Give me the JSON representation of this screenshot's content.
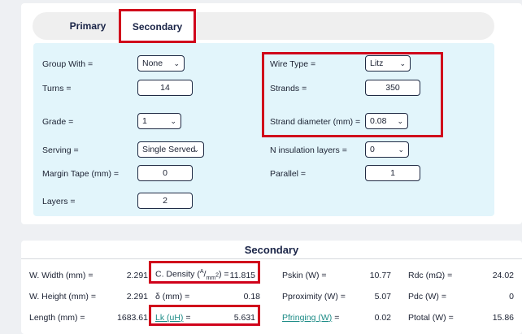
{
  "tabs": {
    "primary": "Primary",
    "secondary": "Secondary"
  },
  "form": {
    "group_with": {
      "label": "Group With =",
      "value": "None"
    },
    "turns": {
      "label": "Turns =",
      "value": "14"
    },
    "grade": {
      "label": "Grade =",
      "value": "1"
    },
    "serving": {
      "label": "Serving =",
      "value": "Single Served"
    },
    "margin_tape": {
      "label": "Margin Tape (mm) =",
      "value": "0"
    },
    "layers": {
      "label": "Layers =",
      "value": "2"
    },
    "wire_type": {
      "label": "Wire Type =",
      "value": "Litz"
    },
    "strands": {
      "label": "Strands =",
      "value": "350"
    },
    "strand_diameter": {
      "label": "Strand diameter (mm) =",
      "value": "0.08"
    },
    "insulation_layers": {
      "label": "N insulation layers =",
      "value": "0"
    },
    "parallel": {
      "label": "Parallel =",
      "value": "1"
    }
  },
  "results": {
    "title": "Secondary",
    "w_width": {
      "label": "W. Width (mm) =",
      "value": "2.291"
    },
    "w_height": {
      "label": "W. Height (mm) =",
      "value": "2.291"
    },
    "length": {
      "label": "Length (mm) =",
      "value": "1683.61"
    },
    "c_density": {
      "label_pre": "C. Density (",
      "label_num": "A",
      "label_slash": "/",
      "label_den": "mm",
      "label_exp": "2",
      "label_post": ") =",
      "value": "11.815"
    },
    "delta": {
      "label": "δ (mm) =",
      "value": "0.18"
    },
    "lk": {
      "label": "Lk (uH)",
      "eq": "=",
      "value": "5.631"
    },
    "pskin": {
      "label": "Pskin (W) =",
      "value": "10.77"
    },
    "pproximity": {
      "label": "Pproximity (W) =",
      "value": "5.07"
    },
    "pfringing": {
      "label": "Pfringing (W)",
      "eq": "=",
      "value": "0.02"
    },
    "rdc": {
      "label": "Rdc (mΩ) =",
      "value": "24.02"
    },
    "pdc": {
      "label": "Pdc (W) =",
      "value": "0"
    },
    "ptotal": {
      "label": "Ptotal (W) =",
      "value": "15.86"
    }
  },
  "icons": {
    "select_chevron": "chevron-down-icon"
  },
  "colors": {
    "highlight": "#d0021b",
    "panel": "#e2f5fb",
    "link": "#1a8a85"
  }
}
